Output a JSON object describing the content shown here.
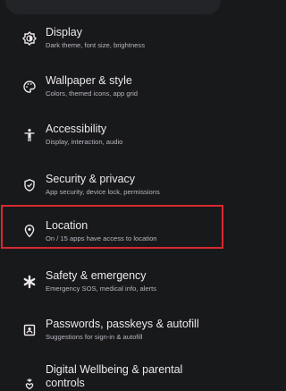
{
  "settings_items": [
    {
      "title": "Display",
      "subtitle": "Dark theme, font size, brightness",
      "icon": "brightness-icon"
    },
    {
      "title": "Wallpaper & style",
      "subtitle": "Colors, themed icons, app grid",
      "icon": "palette-icon"
    },
    {
      "title": "Accessibility",
      "subtitle": "Display, interaction, audio",
      "icon": "accessibility-icon"
    },
    {
      "title": "Security & privacy",
      "subtitle": "App security, device lock, permissions",
      "icon": "shield-icon"
    },
    {
      "title": "Location",
      "subtitle": "On / 15 apps have access to location",
      "icon": "location-pin-icon"
    },
    {
      "title": "Safety & emergency",
      "subtitle": "Emergency SOS, medical info, alerts",
      "icon": "asterisk-icon"
    },
    {
      "title": "Passwords, passkeys & autofill",
      "subtitle": "Suggestions for sign-in & autofill",
      "icon": "key-card-icon"
    },
    {
      "title": "Digital Wellbeing & parental controls",
      "subtitle": "",
      "icon": "wellbeing-icon"
    }
  ],
  "colors": {
    "background": "#18191b",
    "highlight_border": "#d8292f",
    "title_text": "#ece8ee",
    "subtitle_text": "#b9b5bf"
  }
}
